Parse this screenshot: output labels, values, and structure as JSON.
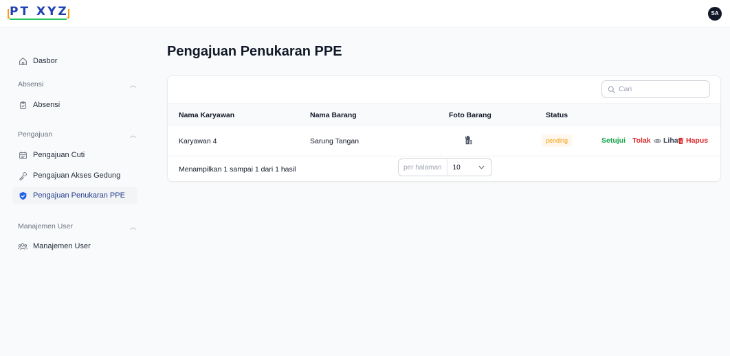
{
  "app": {
    "logo_text": "PT XYZ",
    "user_initials": "SA"
  },
  "sidebar": {
    "dashboard": "Dasbor",
    "sections": [
      {
        "title": "Absensi",
        "items": [
          "Absensi"
        ]
      },
      {
        "title": "Pengajuan",
        "items": [
          "Pengajuan Cuti",
          "Pengajuan Akses Gedung",
          "Pengajuan Penukaran PPE"
        ]
      },
      {
        "title": "Manajemen User",
        "items": [
          "Manajemen User"
        ]
      }
    ],
    "active_item": "Pengajuan Penukaran PPE"
  },
  "main": {
    "title": "Pengajuan Penukaran PPE",
    "search": {
      "placeholder": "Cari",
      "value": ""
    },
    "table": {
      "columns": [
        "Nama Karyawan",
        "Nama Barang",
        "Foto Barang",
        "Status"
      ],
      "rows": [
        {
          "employee": "Karyawan 4",
          "item": "Sarung Tangan",
          "photo_icon": "glove-icon",
          "status": "pending",
          "actions": {
            "approve": "Setujui",
            "reject": "Tolak",
            "view": "Lihat",
            "delete": "Hapus"
          }
        }
      ]
    },
    "footer": {
      "summary": "Menampilkan 1 sampai 1 dari 1 hasil",
      "per_page_label": "per halaman",
      "per_page_value": "10"
    }
  },
  "colors": {
    "brand": "#1e40af",
    "approve": "#16a34a",
    "reject": "#dc2626",
    "pending_text": "#f59e0b",
    "pending_bg": "#fff7ed"
  }
}
